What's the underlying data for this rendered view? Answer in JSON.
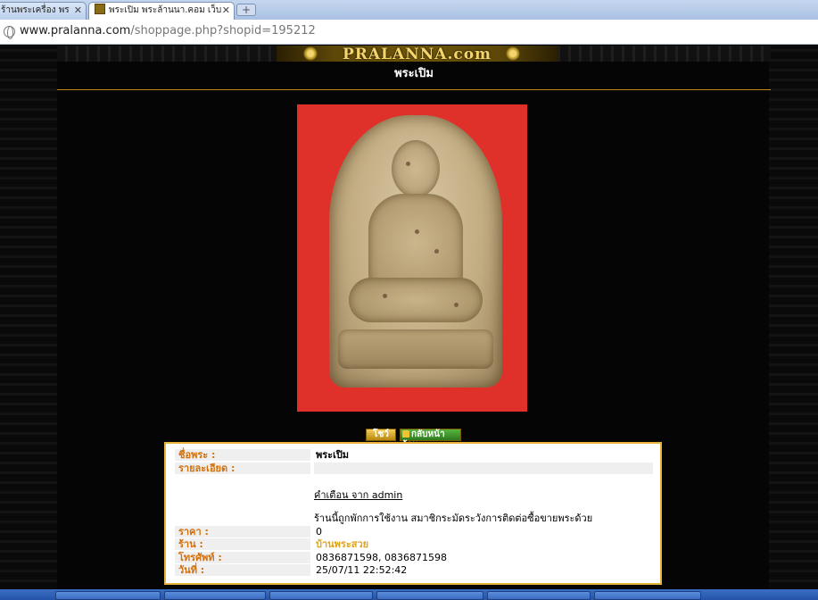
{
  "browser": {
    "tabs": [
      {
        "title": "ร้านพระเครื่อง พร",
        "active": false
      },
      {
        "title": "พระเปิม พระล้านนา.คอม เว็บ",
        "active": true
      }
    ],
    "url_host": "www.pralanna.com",
    "url_path": "/shoppage.php?shopid=195212"
  },
  "banner": {
    "logo_text": "PRALANNA.com"
  },
  "page": {
    "title": "พระเปิม"
  },
  "buttons": {
    "show_label": "โชว์",
    "back_label": "กลับหน้าร้าน"
  },
  "info": {
    "name_label": "ชื่อพระ :",
    "name_value": "พระเปิม",
    "detail_label": "รายละเอียด :",
    "warning_link": "คำเตือน จาก admin",
    "warning_text": "ร้านนี้ถูกพักการใช้งาน สมาชิกระมัดระวังการติดต่อซื้อขายพระด้วย",
    "price_label": "ราคา :",
    "price_value": "0",
    "shop_label": "ร้าน :",
    "shop_value": "บ้านพระสวย",
    "phone_label": "โทรศัพท์ :",
    "phone_value": "0836871598, 0836871598",
    "date_label": "วันที่ :",
    "date_value": "25/07/11 22:52:42"
  },
  "colors": {
    "accent_gold": "#e6b43a",
    "label_orange": "#d4700a",
    "photo_bg": "#e0302a"
  }
}
